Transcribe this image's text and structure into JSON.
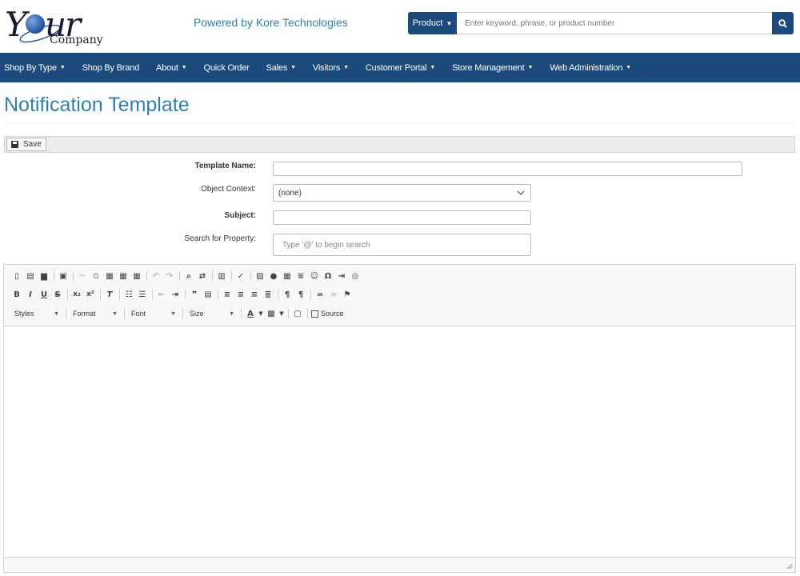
{
  "brand": {
    "logo_main": "Y",
    "logo_rest": "ur",
    "logo_sub": "Company",
    "powered_by": "Powered by Kore Technologies"
  },
  "search": {
    "category_label": "Product",
    "placeholder": "Enter keyword, phrase, or product number"
  },
  "nav": {
    "items": [
      {
        "label": "Shop By Type",
        "dropdown": true
      },
      {
        "label": "Shop By Brand",
        "dropdown": false
      },
      {
        "label": "About",
        "dropdown": true
      },
      {
        "label": "Quick Order",
        "dropdown": false
      },
      {
        "label": "Sales",
        "dropdown": true
      },
      {
        "label": "Visitors",
        "dropdown": true
      },
      {
        "label": "Customer Portal",
        "dropdown": true
      },
      {
        "label": "Store Management",
        "dropdown": true
      },
      {
        "label": "Web Administration",
        "dropdown": true
      }
    ]
  },
  "page": {
    "title": "Notification Template"
  },
  "toolbar": {
    "save_label": "Save"
  },
  "form": {
    "template_name_label": "Template Name:",
    "template_name_value": "",
    "object_context_label": "Object Context:",
    "object_context_value": "(none)",
    "subject_label": "Subject:",
    "subject_value": "",
    "search_property_label": "Search for Property:",
    "search_property_placeholder": "Type '@' to begin search"
  },
  "editor": {
    "styles_label": "Styles",
    "format_label": "Format",
    "font_label": "Font",
    "size_label": "Size",
    "source_label": "Source",
    "content": ""
  },
  "colors": {
    "nav_bg": "#1c4a7c",
    "title": "#2f7fb4"
  }
}
